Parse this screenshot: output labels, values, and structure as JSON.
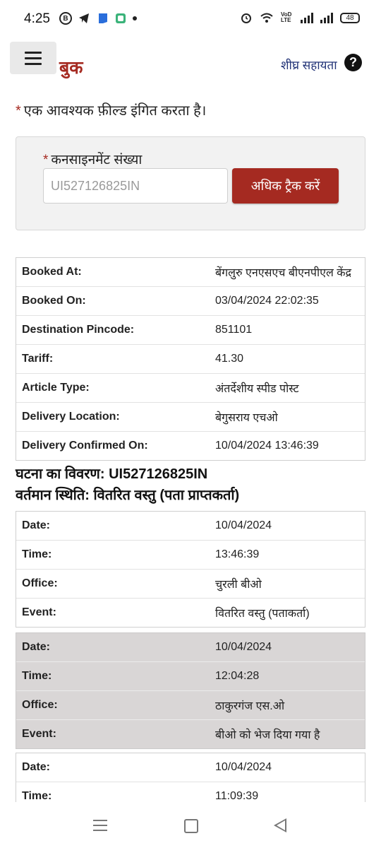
{
  "status_bar": {
    "time": "4:25",
    "battery": "48",
    "lte_label": "VoD LTE"
  },
  "header": {
    "brand": "बुक",
    "help_link": "शीघ्र सहायता",
    "help_icon": "?"
  },
  "required_note": {
    "star": "*",
    "text": "एक आवश्यक फ़ील्ड इंगित करता है।"
  },
  "search": {
    "label_star": "*",
    "label": "कनसाइनमेंट संख्या",
    "input_value": "UI527126825IN",
    "button_label": "अधिक ट्रैक करें"
  },
  "booking_details": [
    {
      "label": "Booked At:",
      "value": "बेंगलुरु एनएसएच बीएनपीएल केंद्र"
    },
    {
      "label": "Booked On:",
      "value": "03/04/2024 22:02:35"
    },
    {
      "label": "Destination Pincode:",
      "value": "851101"
    },
    {
      "label": "Tariff:",
      "value": "41.30"
    },
    {
      "label": "Article Type:",
      "value": "अंतर्देशीय स्पीड पोस्ट"
    },
    {
      "label": "Delivery Location:",
      "value": "बेगुसराय एचओ"
    },
    {
      "label": "Delivery Confirmed On:",
      "value": "10/04/2024 13:46:39"
    }
  ],
  "events_heading": {
    "line1": "घटना का विवरण: UI527126825IN",
    "line2": "वर्तमान स्थिति: वितरित वस्तु (पता प्राप्तकर्ता)"
  },
  "events": [
    {
      "date_label": "Date:",
      "date": "10/04/2024",
      "time_label": "Time:",
      "time": "13:46:39",
      "office_label": "Office:",
      "office": "चुरली बीओ",
      "event_label": "Event:",
      "event": "वितरित वस्तु (पताकर्ता)"
    },
    {
      "date_label": "Date:",
      "date": "10/04/2024",
      "time_label": "Time:",
      "time": "12:04:28",
      "office_label": "Office:",
      "office": "ठाकुरगंज एस.ओ",
      "event_label": "Event:",
      "event": "बीओ को भेज दिया गया है"
    },
    {
      "date_label": "Date:",
      "date": "10/04/2024",
      "time_label": "Time:",
      "time": "11:09:39"
    }
  ],
  "icons": {
    "status_left": [
      "b-icon",
      "telegram-icon",
      "app-icon",
      "app-icon"
    ],
    "status_right": [
      "alarm-icon",
      "wifi-icon",
      "signal-icon",
      "signal-icon",
      "battery-icon"
    ],
    "nav": [
      "recents-icon",
      "home-icon",
      "back-icon"
    ]
  },
  "colors": {
    "accent": "#a52a21",
    "link": "#223377",
    "shaded_row": "#d9d6d6"
  }
}
